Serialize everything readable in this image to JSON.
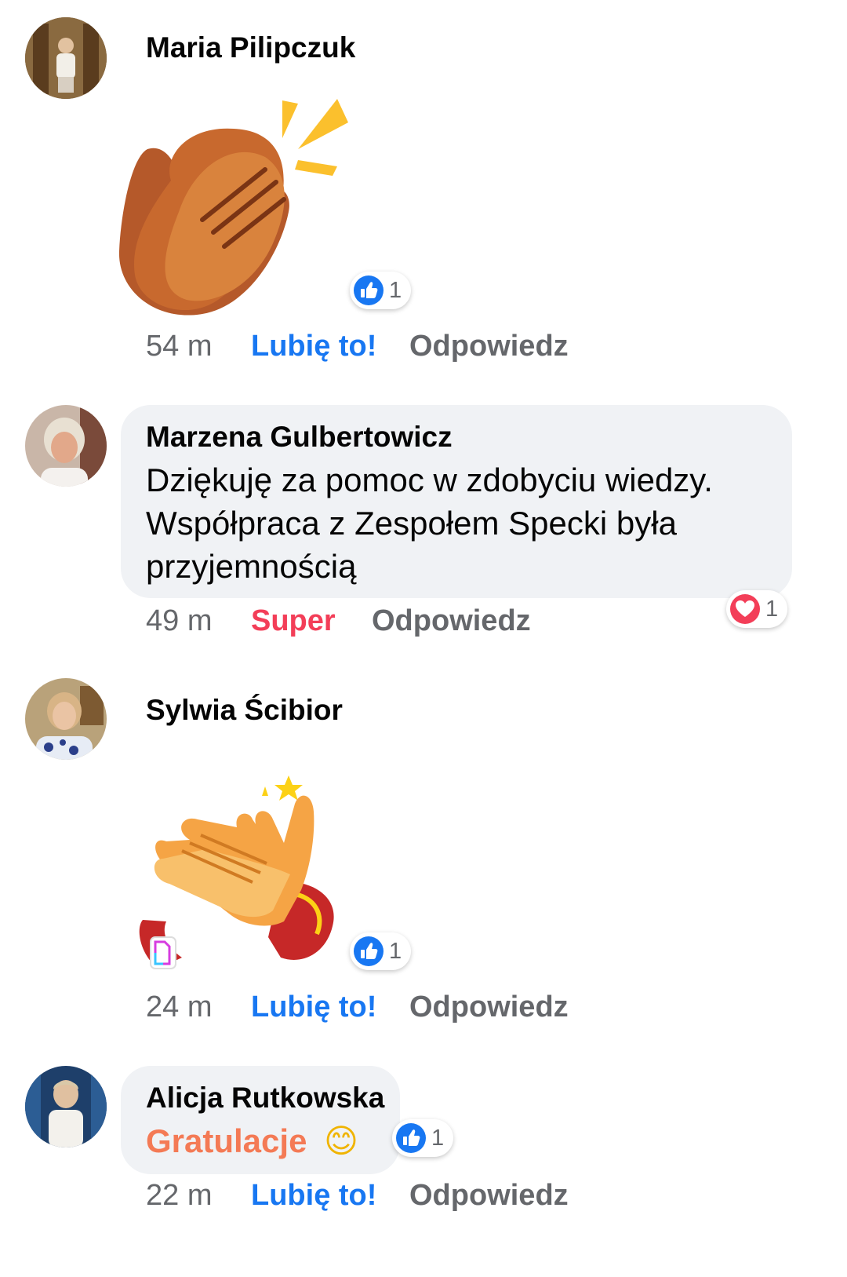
{
  "comments": [
    {
      "author": "Maria Pilipczuk",
      "sticker": "clapping-hands-sticker",
      "reaction": {
        "icon": "like-icon",
        "count": "1"
      },
      "time": "54 m",
      "action": "Lubię to!",
      "reply": "Odpowiedz"
    },
    {
      "author": "Marzena Gulbertowicz",
      "text_lines": [
        "Dziękuję za pomoc w zdobyciu wiedzy.",
        "Współpraca z Zespołem Specki była",
        "przyjemnością"
      ],
      "reaction": {
        "icon": "heart-icon",
        "count": "1"
      },
      "time": "49 m",
      "action": "Super",
      "reply": "Odpowiedz"
    },
    {
      "author": "Sylwia Ścibior",
      "sticker": "animated-clapping-hands-gif",
      "reaction": {
        "icon": "like-icon",
        "count": "1"
      },
      "time": "24 m",
      "action": "Lubię to!",
      "reply": "Odpowiedz"
    },
    {
      "author": "Alicja Rutkowska",
      "text": "Gratulacje",
      "emoji": "😊",
      "reaction": {
        "icon": "like-icon",
        "count": "1"
      },
      "time": "22 m",
      "action": "Lubię to!",
      "reply": "Odpowiedz"
    }
  ],
  "colors": {
    "like_blue": "#1877f2",
    "super_red": "#f33e58",
    "meta_gray": "#65676b",
    "bubble_bg": "#f0f2f5",
    "gratulacje_orange": "#f47a55"
  }
}
